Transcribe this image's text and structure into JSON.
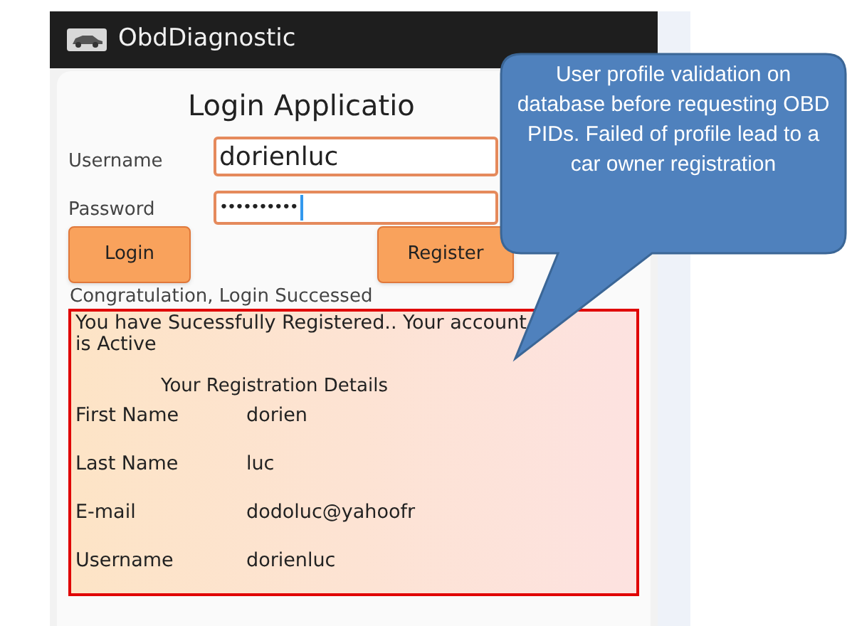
{
  "app_bar": {
    "title": "ObdDiagnostic"
  },
  "login": {
    "title": "Login Applicatio",
    "fields": [
      {
        "label": "Username",
        "value": "dorienluc",
        "kind": "text",
        "focused": false
      },
      {
        "label": "Password",
        "value": "••••••••••",
        "kind": "password",
        "focused": true
      }
    ],
    "buttons": [
      "Login",
      "Register"
    ],
    "status": "Congratulation, Login Successed"
  },
  "registration": {
    "message": "You have Sucessfully Registered.. Your account is Active",
    "heading": "Your Registration Details",
    "rows": [
      {
        "label": "First Name",
        "value": "dorien"
      },
      {
        "label": "Last Name",
        "value": "luc"
      },
      {
        "label": "E-mail",
        "value": "dodoluc@yahoofr"
      },
      {
        "label": "Username",
        "value": "dorienluc"
      }
    ]
  },
  "callout": {
    "text": "User profile validation on database before requesting OBD PIDs. Failed of profile lead to a car owner registration"
  }
}
